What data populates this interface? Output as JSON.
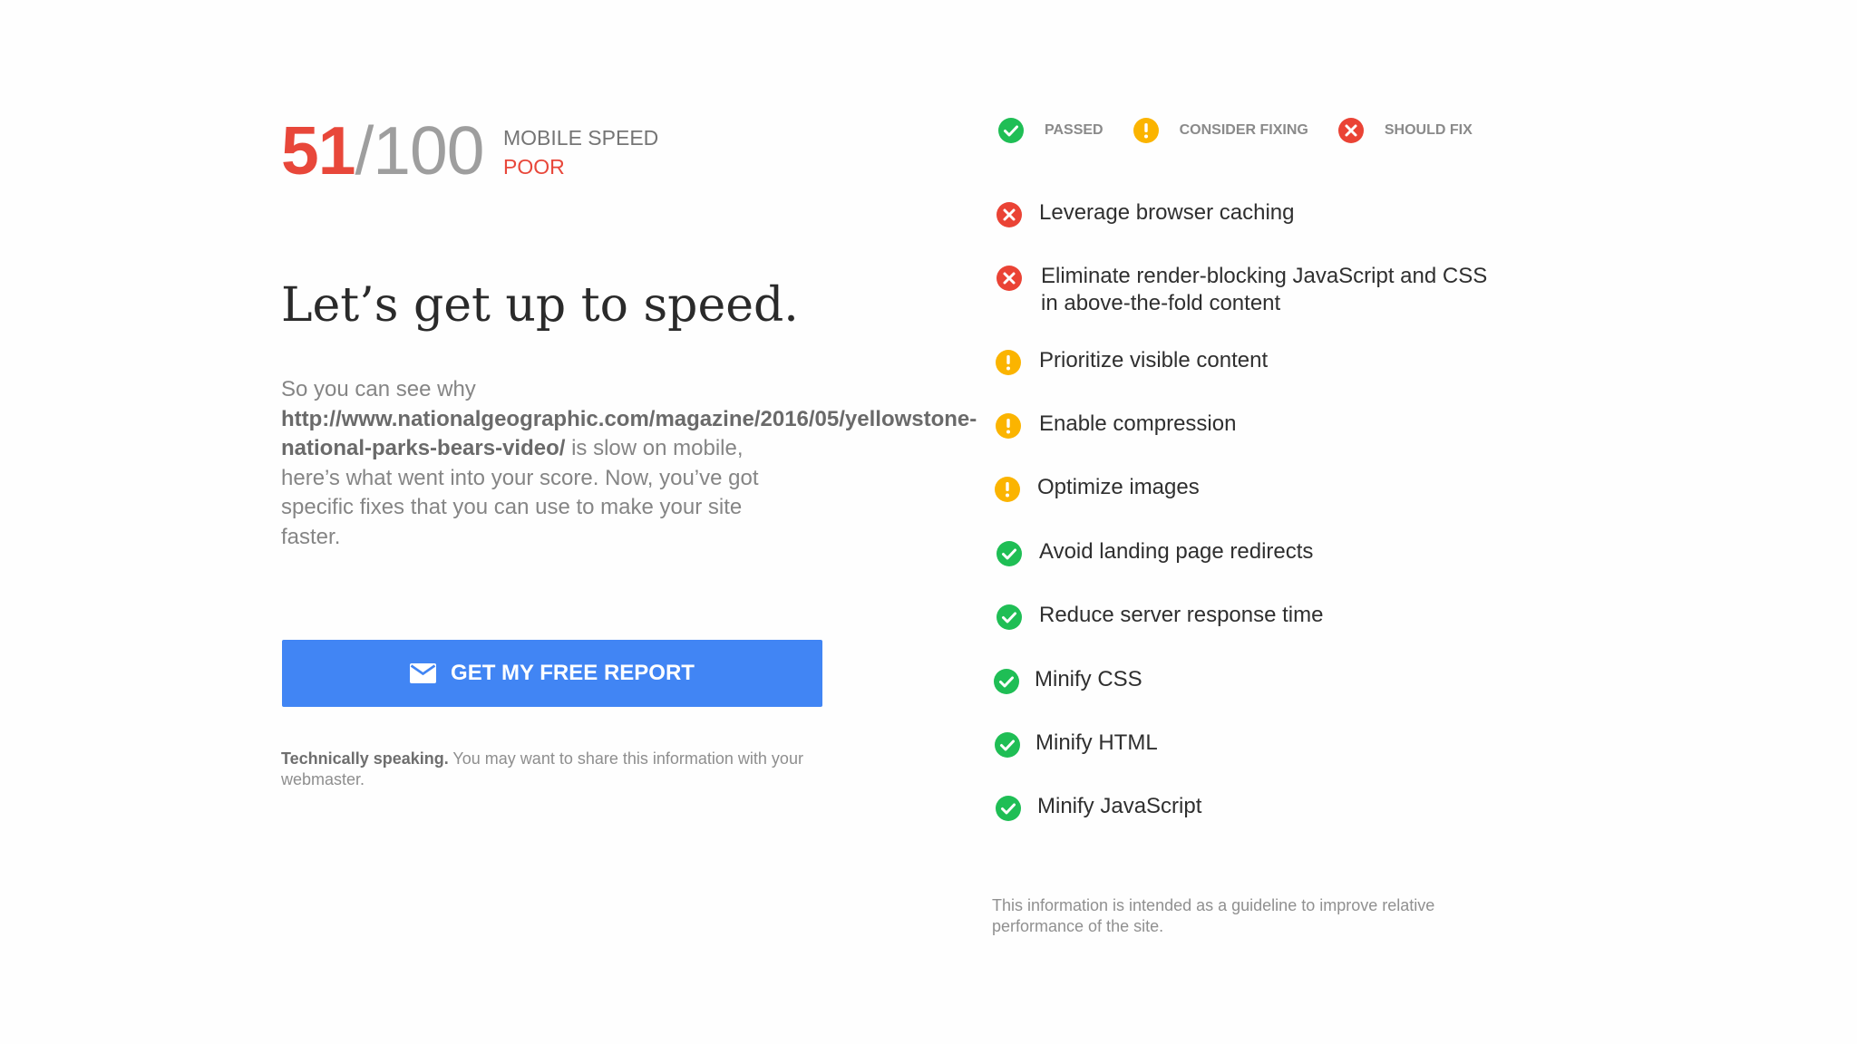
{
  "score": {
    "value": "51",
    "total": "/100",
    "label": "MOBILE SPEED",
    "rating": "POOR"
  },
  "headline": "Let’s get up to speed.",
  "description": {
    "intro": "So you can see why",
    "url_line1": "http://www.nationalgeographic.com/magazine/2016/05/yellowstone-",
    "url_line2": "national-parks-bears-video/",
    "body": " is slow on mobile, here’s what went into your score. Now, you’ve got specific fixes that you can use to make your site faster."
  },
  "cta": {
    "label": "GET MY FREE REPORT",
    "icon": "mail-icon"
  },
  "note": {
    "bold": "Technically speaking.",
    "text": " You may want to share this information with your webmaster."
  },
  "legend": [
    {
      "status": "passed",
      "label": "PASSED"
    },
    {
      "status": "consider",
      "label": "CONSIDER FIXING"
    },
    {
      "status": "fix",
      "label": "SHOULD FIX"
    }
  ],
  "rules": [
    {
      "status": "fix",
      "label": "Leverage browser caching"
    },
    {
      "status": "fix",
      "label": "Eliminate render-blocking JavaScript and CSS in above-the-fold content"
    },
    {
      "status": "consider",
      "label": "Prioritize visible content"
    },
    {
      "status": "consider",
      "label": "Enable compression"
    },
    {
      "status": "consider",
      "label": "Optimize images"
    },
    {
      "status": "passed",
      "label": "Avoid landing page redirects"
    },
    {
      "status": "passed",
      "label": "Reduce server response time"
    },
    {
      "status": "passed",
      "label": "Minify CSS"
    },
    {
      "status": "passed",
      "label": "Minify HTML"
    },
    {
      "status": "passed",
      "label": "Minify JavaScript"
    }
  ],
  "disclaimer": "This information is intended as a guideline to improve relative performance of the site.",
  "colors": {
    "passed": "#1fbe55",
    "consider": "#fbb400",
    "fix": "#ea4335",
    "score": "#e8473a",
    "button": "#4185f4"
  }
}
